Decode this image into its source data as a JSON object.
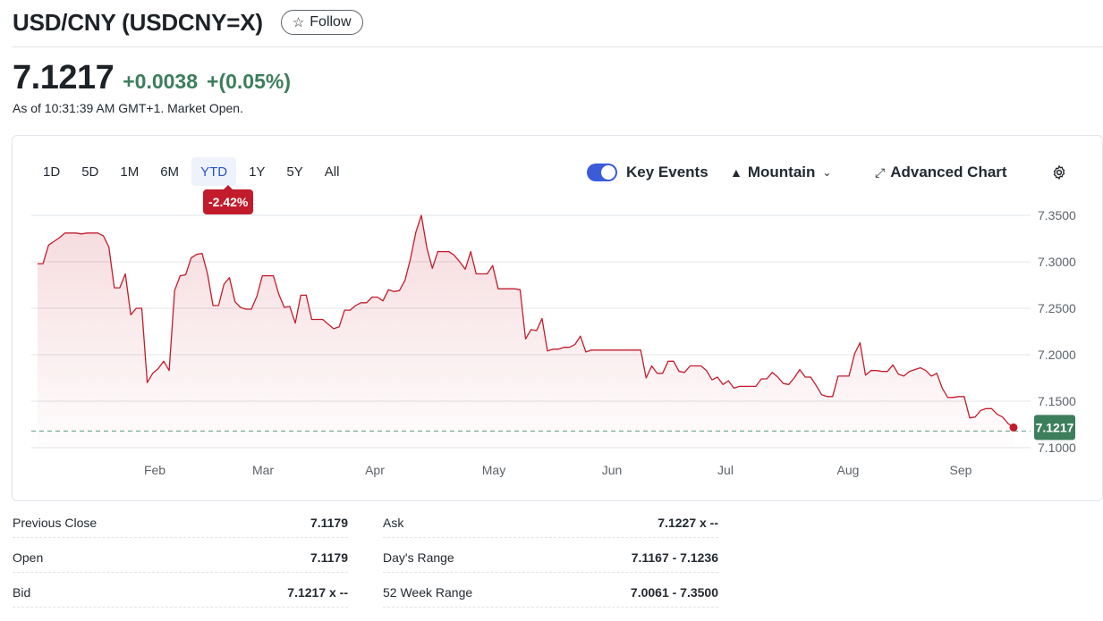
{
  "header": {
    "title": "USD/CNY (USDCNY=X)",
    "follow_label": "Follow",
    "follow_icon": "star-outline-icon"
  },
  "quote": {
    "price": "7.1217",
    "change": "+0.0038",
    "change_pct": "+(0.05%)",
    "as_of": "As of 10:31:39 AM GMT+1. Market Open.",
    "positive_color": "#3d7e5c"
  },
  "ranges": [
    "1D",
    "5D",
    "1M",
    "6M",
    "YTD",
    "1Y",
    "5Y",
    "All"
  ],
  "active_range": "YTD",
  "ytd_change": "-2.42%",
  "tools": {
    "key_events_label": "Key Events",
    "key_events_on": true,
    "chart_type_label": "Mountain",
    "advanced_label": "Advanced Chart",
    "settings_icon": "gear-icon"
  },
  "chart_data": {
    "type": "area",
    "x_months": [
      "Feb",
      "Mar",
      "Apr",
      "May",
      "Jun",
      "Jul",
      "Aug",
      "Sep"
    ],
    "y_ticks": [
      "7.3500",
      "7.3000",
      "7.2500",
      "7.2000",
      "7.1500",
      "7.1000"
    ],
    "ylim": [
      7.1,
      7.35
    ],
    "grid": true,
    "line_color": "#c21c2c",
    "previous_close": 7.1179,
    "last_price_label": "7.1217",
    "series": [
      {
        "values": [
          7.298,
          7.298,
          7.318,
          7.322,
          7.326,
          7.331,
          7.331,
          7.331,
          7.33,
          7.331,
          7.331,
          7.331,
          7.328,
          7.316,
          7.272,
          7.272,
          7.287,
          7.243,
          7.25,
          7.25,
          7.17,
          7.18,
          7.185,
          7.193,
          7.183,
          7.269,
          7.285,
          7.286,
          7.304,
          7.308,
          7.309,
          7.287,
          7.253,
          7.253,
          7.276,
          7.283,
          7.257,
          7.251,
          7.249,
          7.249,
          7.263,
          7.285,
          7.285,
          7.285,
          7.265,
          7.251,
          7.252,
          7.234,
          7.264,
          7.264,
          7.238,
          7.238,
          7.238,
          7.233,
          7.228,
          7.23,
          7.248,
          7.248,
          7.253,
          7.256,
          7.256,
          7.262,
          7.262,
          7.258,
          7.27,
          7.268,
          7.269,
          7.28,
          7.303,
          7.332,
          7.35,
          7.315,
          7.293,
          7.311,
          7.311,
          7.311,
          7.307,
          7.3,
          7.292,
          7.311,
          7.287,
          7.287,
          7.287,
          7.296,
          7.271,
          7.271,
          7.271,
          7.271,
          7.27,
          7.217,
          7.227,
          7.226,
          7.239,
          7.204,
          7.206,
          7.206,
          7.208,
          7.208,
          7.211,
          7.22,
          7.203,
          7.205,
          7.205,
          7.205,
          7.205,
          7.205,
          7.205,
          7.205,
          7.205,
          7.205,
          7.205,
          7.175,
          7.188,
          7.18,
          7.18,
          7.193,
          7.193,
          7.182,
          7.181,
          7.188,
          7.188,
          7.188,
          7.183,
          7.173,
          7.176,
          7.168,
          7.172,
          7.164,
          7.166,
          7.166,
          7.166,
          7.166,
          7.174,
          7.174,
          7.181,
          7.176,
          7.169,
          7.168,
          7.175,
          7.184,
          7.176,
          7.176,
          7.167,
          7.157,
          7.155,
          7.155,
          7.177,
          7.177,
          7.177,
          7.201,
          7.213,
          7.178,
          7.183,
          7.183,
          7.182,
          7.182,
          7.189,
          7.179,
          7.177,
          7.182,
          7.184,
          7.186,
          7.183,
          7.177,
          7.18,
          7.164,
          7.154,
          7.154,
          7.155,
          7.155,
          7.132,
          7.133,
          7.14,
          7.142,
          7.142,
          7.136,
          7.133,
          7.126,
          7.1217
        ]
      }
    ]
  },
  "stats": [
    {
      "label": "Previous Close",
      "value": "7.1179"
    },
    {
      "label": "Open",
      "value": "7.1179"
    },
    {
      "label": "Bid",
      "value": "7.1217 x --"
    },
    {
      "label": "Ask",
      "value": "7.1227 x --"
    },
    {
      "label": "Day's Range",
      "value": "7.1167 - 7.1236"
    },
    {
      "label": "52 Week Range",
      "value": "7.0061 - 7.3500"
    }
  ]
}
